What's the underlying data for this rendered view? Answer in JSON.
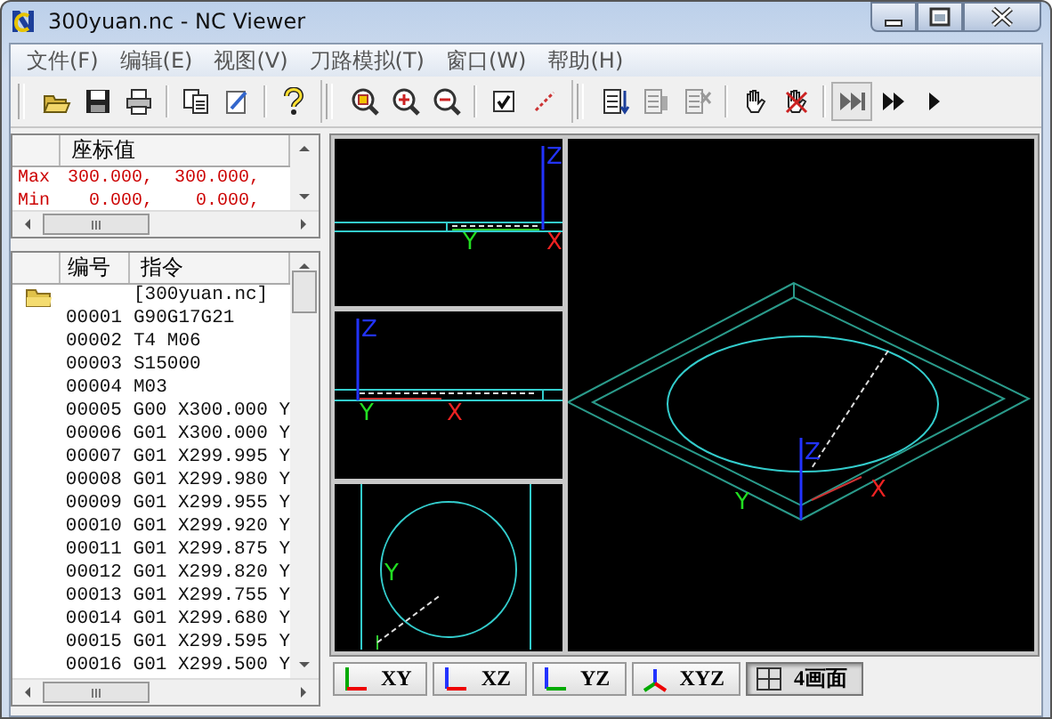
{
  "window": {
    "title": "300yuan.nc - NC Viewer"
  },
  "menu": [
    {
      "label": "文件(F)"
    },
    {
      "label": "编辑(E)"
    },
    {
      "label": "视图(V)"
    },
    {
      "label": "刀路模拟(T)"
    },
    {
      "label": "窗口(W)"
    },
    {
      "label": "帮助(H)"
    }
  ],
  "coordinates": {
    "column": "座标值",
    "rows": [
      {
        "label": "Max",
        "values": "300.000,  300.000,"
      },
      {
        "label": "Min",
        "values": "  0.000,    0.000,"
      }
    ]
  },
  "program": {
    "columns": [
      "编号",
      "指令"
    ],
    "file": "[300yuan.nc]",
    "rows": [
      {
        "number": "00001",
        "command": "G90G17G21"
      },
      {
        "number": "00002",
        "command": "T4 M06"
      },
      {
        "number": "00003",
        "command": "S15000"
      },
      {
        "number": "00004",
        "command": "M03"
      },
      {
        "number": "00005",
        "command": "G00 X300.000 Y"
      },
      {
        "number": "00006",
        "command": "G01 X300.000 Y"
      },
      {
        "number": "00007",
        "command": "G01 X299.995 Y"
      },
      {
        "number": "00008",
        "command": "G01 X299.980 Y"
      },
      {
        "number": "00009",
        "command": "G01 X299.955 Y"
      },
      {
        "number": "00010",
        "command": "G01 X299.920 Y"
      },
      {
        "number": "00011",
        "command": "G01 X299.875 Y"
      },
      {
        "number": "00012",
        "command": "G01 X299.820 Y"
      },
      {
        "number": "00013",
        "command": "G01 X299.755 Y"
      },
      {
        "number": "00014",
        "command": "G01 X299.680 Y"
      },
      {
        "number": "00015",
        "command": "G01 X299.595 Y"
      },
      {
        "number": "00016",
        "command": "G01 X299.500 Y"
      }
    ]
  },
  "viewports": [
    {
      "kind": "front",
      "labels": [
        {
          "text": "Z",
          "color": "#2233ff"
        },
        {
          "text": "Y",
          "color": "#22dd22"
        },
        {
          "text": "X",
          "color": "#ee2222"
        }
      ]
    },
    {
      "kind": "side",
      "labels": [
        {
          "text": "Z",
          "color": "#2233ff"
        },
        {
          "text": "Y",
          "color": "#22dd22"
        },
        {
          "text": "X",
          "color": "#ee2222"
        }
      ]
    },
    {
      "kind": "top",
      "labels": [
        {
          "text": "Y",
          "color": "#22dd22"
        }
      ]
    },
    {
      "kind": "iso",
      "labels": [
        {
          "text": "Z",
          "color": "#2233ff"
        },
        {
          "text": "Y",
          "color": "#22dd22"
        },
        {
          "text": "X",
          "color": "#ee2222"
        }
      ]
    }
  ],
  "view_tabs": [
    {
      "label": "XY",
      "kind": "xy",
      "selected": false
    },
    {
      "label": "XZ",
      "kind": "xz",
      "selected": false
    },
    {
      "label": "YZ",
      "kind": "yz",
      "selected": false
    },
    {
      "label": "XYZ",
      "kind": "xyz",
      "selected": false
    },
    {
      "label": "4画面",
      "kind": "quad",
      "selected": true
    }
  ]
}
